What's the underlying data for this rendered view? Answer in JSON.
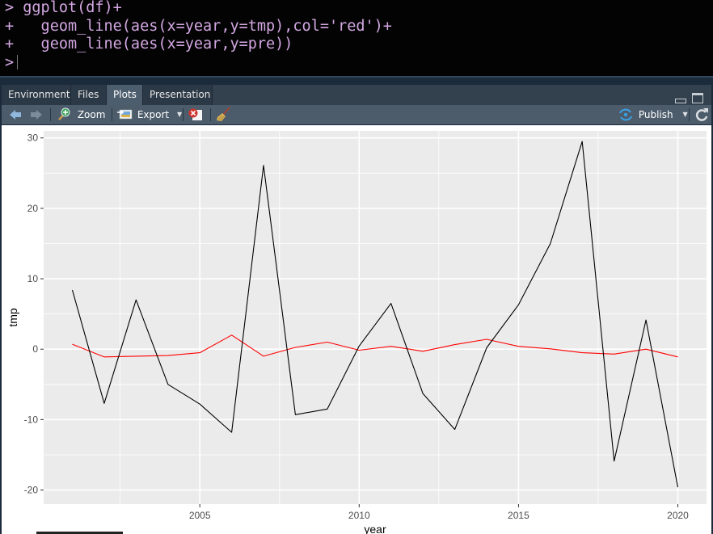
{
  "console": {
    "lines": [
      {
        "prompt": ">",
        "code": "ggplot(df)+"
      },
      {
        "prompt": "+",
        "code": "  geom_line(aes(x=year,y=tmp),col='red')+"
      },
      {
        "prompt": "+",
        "code": "  geom_line(aes(x=year,y=pre))"
      },
      {
        "prompt": ">",
        "code": ""
      }
    ]
  },
  "tabs": [
    {
      "label": "Environment",
      "active": false
    },
    {
      "label": "Files",
      "active": false
    },
    {
      "label": "Plots",
      "active": true
    },
    {
      "label": "Presentation",
      "active": false
    }
  ],
  "toolbar": {
    "back_icon": "arrow-left-icon",
    "forward_icon": "arrow-right-icon",
    "zoom_label": "Zoom",
    "export_label": "Export",
    "remove_icon": "remove-plot-icon",
    "clear_icon": "broom-icon",
    "publish_label": "Publish",
    "refresh_icon": "refresh-icon"
  },
  "colors": {
    "red_series": "#ff0000",
    "black_series": "#000000",
    "panel_bg": "#ebebeb",
    "grid": "#ffffff"
  },
  "chart_data": {
    "type": "line",
    "title": "",
    "xlabel": "year",
    "ylabel": "tmp",
    "xlim": [
      2000.1,
      2020.9
    ],
    "ylim": [
      -22,
      31
    ],
    "x_ticks": [
      2005,
      2010,
      2015,
      2020
    ],
    "y_ticks": [
      -20,
      -10,
      0,
      10,
      20,
      30
    ],
    "grid": true,
    "legend": "none",
    "x": [
      2001,
      2002,
      2003,
      2004,
      2005,
      2006,
      2007,
      2008,
      2009,
      2010,
      2011,
      2012,
      2013,
      2014,
      2015,
      2016,
      2017,
      2018,
      2019,
      2020
    ],
    "series": [
      {
        "name": "tmp",
        "color": "#ff0000",
        "values": [
          0.7,
          -1.1,
          -1.0,
          -0.9,
          -0.5,
          2.0,
          -1.0,
          0.25,
          1.0,
          -0.15,
          0.4,
          -0.3,
          0.65,
          1.4,
          0.4,
          0.05,
          -0.5,
          -0.7,
          0.0,
          -1.1
        ]
      },
      {
        "name": "pre",
        "color": "#000000",
        "values": [
          8.4,
          -7.7,
          7.0,
          -5.0,
          -7.8,
          -11.8,
          26.1,
          -9.3,
          -8.5,
          0.45,
          6.5,
          -6.3,
          -11.4,
          0.2,
          6.3,
          15.0,
          29.5,
          -15.9,
          4.15,
          -19.6
        ]
      }
    ]
  }
}
